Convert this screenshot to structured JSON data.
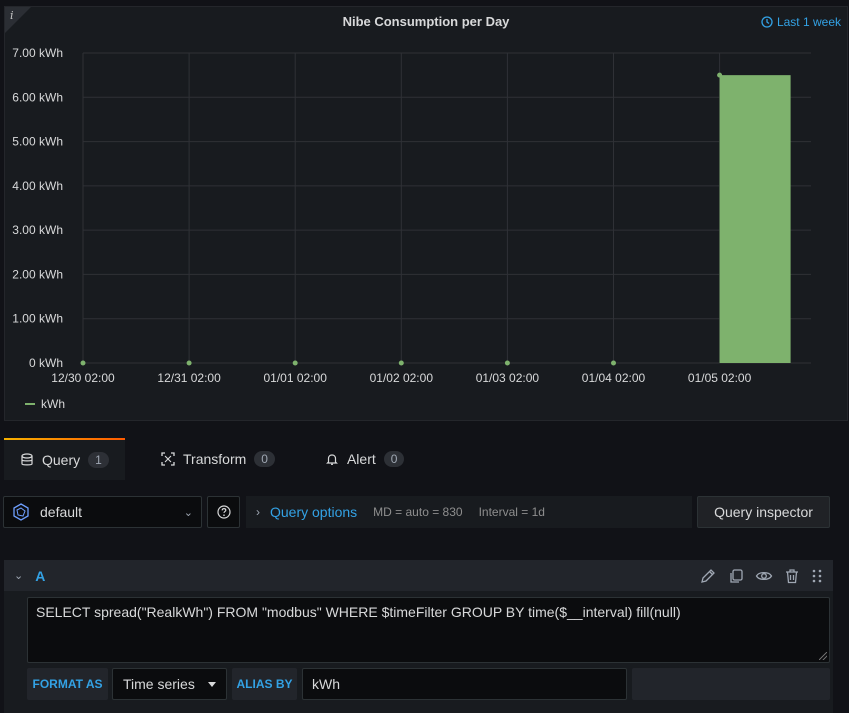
{
  "panel": {
    "info_glyph": "i",
    "title": "Nibe Consumption per Day",
    "time_range": "Last 1 week",
    "time_icon": "clock-icon"
  },
  "chart_data": {
    "type": "bar",
    "title": "Nibe Consumption per Day",
    "y_unit": "kWh",
    "ylim": [
      0,
      7
    ],
    "y_ticks": [
      "0 kWh",
      "1.00 kWh",
      "2.00 kWh",
      "3.00 kWh",
      "4.00 kWh",
      "5.00 kWh",
      "6.00 kWh",
      "7.00 kWh"
    ],
    "x": [
      "12/30 02:00",
      "12/31 02:00",
      "01/01 02:00",
      "01/02 02:00",
      "01/03 02:00",
      "01/04 02:00",
      "01/05 02:00"
    ],
    "series": [
      {
        "name": "kWh",
        "color": "#7eb26d",
        "values": [
          0,
          0,
          0,
          0,
          0,
          0,
          6.5
        ]
      }
    ],
    "grid": true,
    "legend": "bottom-left"
  },
  "tabs": [
    {
      "label": "Query",
      "count": "1",
      "icon": "database-icon",
      "active": true
    },
    {
      "label": "Transform",
      "count": "0",
      "icon": "transform-icon",
      "active": false
    },
    {
      "label": "Alert",
      "count": "0",
      "icon": "bell-icon",
      "active": false
    }
  ],
  "query_row": {
    "datasource": "default",
    "query_options_label": "Query options",
    "md_info": "MD = auto = 830",
    "interval_info": "Interval = 1d",
    "inspector_label": "Query inspector"
  },
  "query_a": {
    "ref": "A",
    "text": "SELECT spread(\"RealkWh\") FROM \"modbus\" WHERE $timeFilter GROUP BY time($__interval) fill(null)",
    "format_label": "FORMAT AS",
    "format_value": "Time series",
    "alias_label": "ALIAS BY",
    "alias_value": "kWh"
  },
  "colors": {
    "accent": "#33a2e5",
    "series": "#7eb26d",
    "tab_gradient_start": "#f7b200",
    "tab_gradient_end": "#ff5a00"
  }
}
